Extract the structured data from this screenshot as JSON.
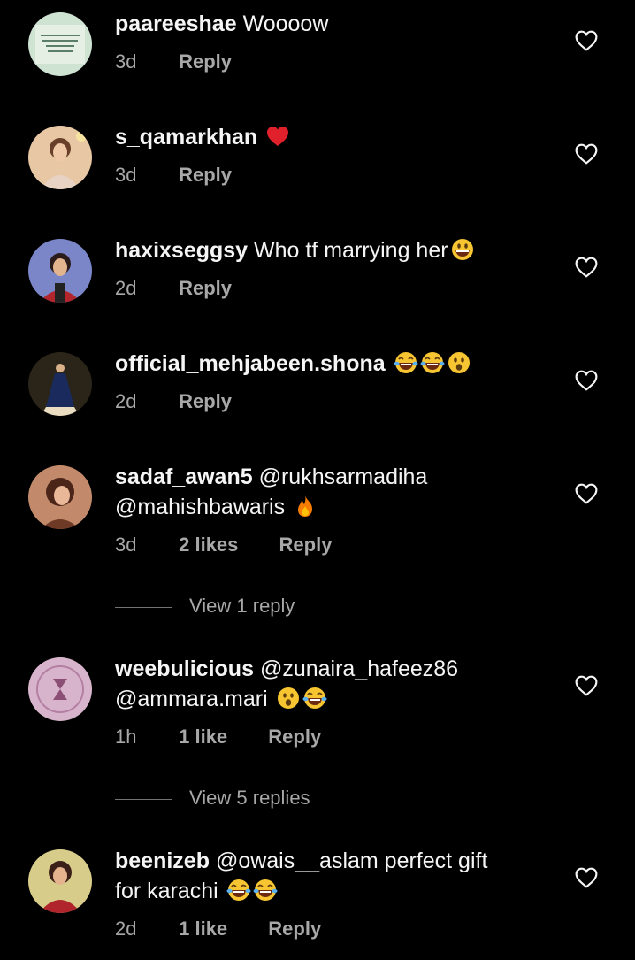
{
  "comments": [
    {
      "username": "paareeshae",
      "text": "Woooow",
      "time": "3d",
      "likes": "",
      "reply": "Reply"
    },
    {
      "username": "s_qamarkhan",
      "text": "",
      "time": "3d",
      "likes": "",
      "reply": "Reply"
    },
    {
      "username": "haxixseggsy",
      "text": "Who tf marrying her",
      "time": "2d",
      "likes": "",
      "reply": "Reply"
    },
    {
      "username": "official_mehjabeen.shona",
      "text": "",
      "time": "2d",
      "likes": "",
      "reply": "Reply"
    },
    {
      "username": "sadaf_awan5",
      "text": "@rukhsarmadiha",
      "text2": "@mahishbawaris",
      "time": "3d",
      "likes": "2 likes",
      "reply": "Reply",
      "view_replies": "View 1 reply"
    },
    {
      "username": "weebulicious",
      "text": "@zunaira_hafeez86",
      "text2": "@ammara.mari",
      "time": "1h",
      "likes": "1 like",
      "reply": "Reply",
      "view_replies": "View 5 replies"
    },
    {
      "username": "beenizeb",
      "text": "@owais__aslam perfect gift",
      "text2": "for karachi",
      "time": "2d",
      "likes": "1 like",
      "reply": "Reply"
    }
  ],
  "icons": {
    "like": "heart-outline-icon",
    "emoji_heart": "red-heart-emoji",
    "emoji_grin": "grinning-face-emoji",
    "emoji_laugh": "tears-of-joy-emoji",
    "emoji_wow": "astonished-face-emoji",
    "emoji_fire": "fire-emoji"
  },
  "colors": {
    "background": "#000000",
    "text": "#f5f5f5",
    "secondary": "#a8a8a8",
    "heart": "#e0202a"
  }
}
